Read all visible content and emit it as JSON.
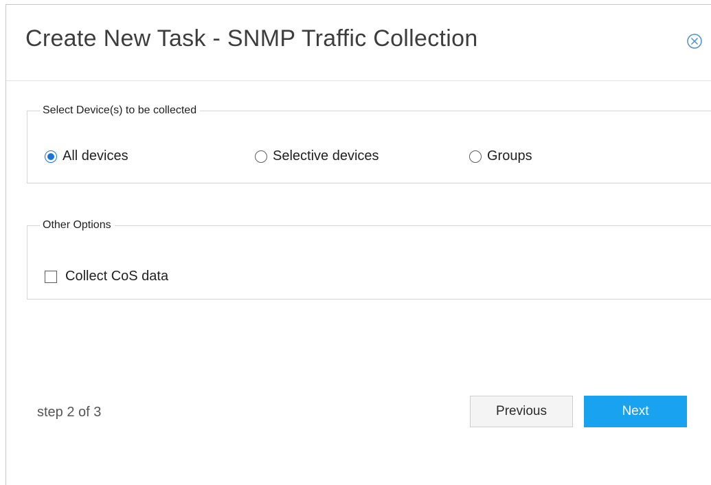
{
  "dialog": {
    "title": "Create New Task - SNMP Traffic Collection",
    "close_icon": "close-circle-icon"
  },
  "devices_section": {
    "legend": "Select Device(s) to be collected",
    "options": [
      {
        "label": "All devices",
        "checked": true
      },
      {
        "label": "Selective devices",
        "checked": false
      },
      {
        "label": "Groups",
        "checked": false
      }
    ]
  },
  "other_options_section": {
    "legend": "Other Options",
    "collect_cos": {
      "label": "Collect CoS data",
      "checked": false
    }
  },
  "footer": {
    "step_text": "step 2 of 3",
    "previous_label": "Previous",
    "next_label": "Next"
  },
  "colors": {
    "accent": "#1a73d6",
    "primary_button": "#18a2f0"
  }
}
